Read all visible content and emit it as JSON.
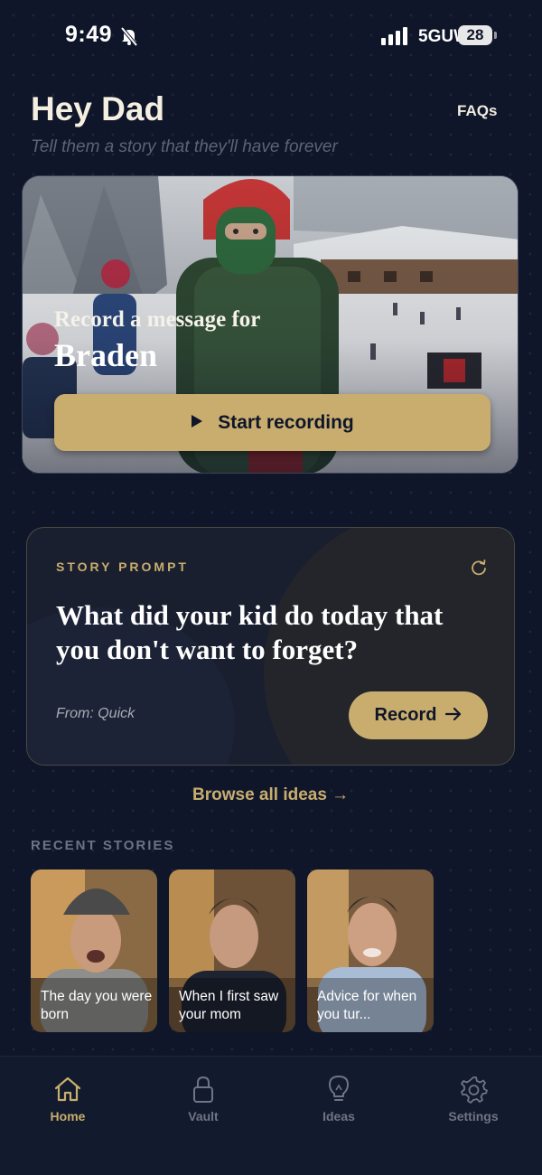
{
  "status_bar": {
    "time": "9:49",
    "network": "5GUW",
    "battery": "28"
  },
  "header": {
    "greeting": "Hey Dad",
    "faqs_label": "FAQs",
    "subtitle": "Tell them a story that they'll have forever"
  },
  "hero": {
    "title": "Record a message for",
    "name": "Braden",
    "button_label": "Start recording"
  },
  "prompt": {
    "label": "STORY PROMPT",
    "question": "What did your kid do today that you don't want to forget?",
    "from": "From: Quick",
    "button_label": "Record"
  },
  "browse_label": "Browse all ideas →",
  "recent": {
    "label": "RECENT STORIES",
    "items": [
      {
        "title": "The day you were born"
      },
      {
        "title": "When I first saw your mom"
      },
      {
        "title": "Advice for when you tur..."
      }
    ]
  },
  "tabs": [
    {
      "label": "Home",
      "icon": "home-icon",
      "active": true
    },
    {
      "label": "Vault",
      "icon": "lock-icon",
      "active": false
    },
    {
      "label": "Ideas",
      "icon": "lightbulb-icon",
      "active": false
    },
    {
      "label": "Settings",
      "icon": "gear-icon",
      "active": false
    }
  ],
  "colors": {
    "background": "#0f1629",
    "accent": "#c8ad6e",
    "card": "#191f2f"
  }
}
